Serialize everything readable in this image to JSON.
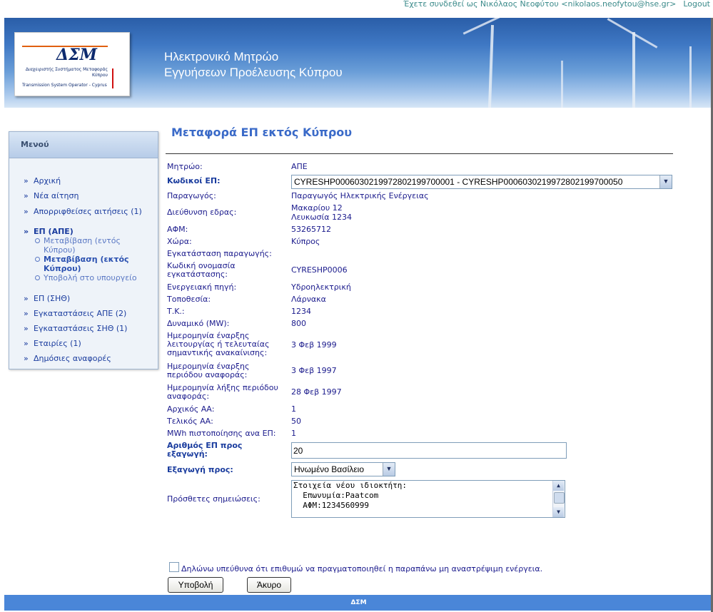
{
  "topbar": {
    "login_text": "Έχετε συνδεθεί ως Νικόλαος Νεοφύτου <nikolaos.neofytou@hse.gr>",
    "logout": "Logout"
  },
  "banner": {
    "logo_main": "ΔΣΜ",
    "logo_sub": "Διαχειριστής Συστήματος Μεταφοράς Κύπρου",
    "logo_en": "Transmission System Operator - Cyprus",
    "title_line1": "Ηλεκτρονικό Μητρώο",
    "title_line2": "Εγγυήσεων Προέλευσης Κύπρου"
  },
  "sidebar": {
    "header": "Μενού",
    "items": [
      "Αρχική",
      "Νέα αίτηση",
      "Απορριφθείσες αιτήσεις (1)",
      "ΕΠ (ΑΠΕ)",
      "ΕΠ (ΣΗΘ)",
      "Εγκαταστάσεις ΑΠΕ (2)",
      "Εγκαταστάσεις ΣΗΘ (1)",
      "Εταιρίες (1)",
      "Δημόσιες αναφορές"
    ],
    "subitems": [
      "Μεταβίβαση (εντός Κύπρου)",
      "Μεταβίβαση (εκτός Κύπρου)",
      "Υποβολή στο υπουργείο"
    ]
  },
  "page": {
    "title": "Μεταφορά ΕΠ εκτός Κύπρου"
  },
  "form": {
    "fields": [
      {
        "label": "Μητρώο:",
        "value": "ΑΠΕ"
      },
      {
        "label": "Κωδικοί ΕΠ:",
        "value": "CYRESHP0006030219972802199700001 - CYRESHP0006030219972802199700050"
      },
      {
        "label": "Παραγωγός:",
        "value": "Παραγωγός Ηλεκτρικής Ενέργειας"
      },
      {
        "label": "Διεύθυνση εδρας:",
        "value": "Μακαρίου 12",
        "value2": "Λευκωσία 1234"
      },
      {
        "label": "ΑΦΜ:",
        "value": "53265712"
      },
      {
        "label": "Χώρα:",
        "value": "Κύπρος"
      },
      {
        "label": "Εγκατάσταση παραγωγής:",
        "value": ""
      },
      {
        "label": "Κωδική ονομασία εγκατάστασης:",
        "value": "CYRESHP0006"
      },
      {
        "label": "Ενεργειακή πηγή:",
        "value": "Υδροηλεκτρική"
      },
      {
        "label": "Τοποθεσία:",
        "value": "Λάρνακα"
      },
      {
        "label": "Τ.Κ.:",
        "value": "1234"
      },
      {
        "label": "Δυναμικό (MW):",
        "value": "800"
      },
      {
        "label": "Ημερομηνία έναρξης λειτουργίας ή τελευταίας σημαντικής ανακαίνισης:",
        "value": "3 Φεβ 1999"
      },
      {
        "label": "Ημερομηνία έναρξης περιόδου αναφοράς:",
        "value": "3 Φεβ 1997"
      },
      {
        "label": "Ημερομηνία λήξης περιόδου αναφοράς:",
        "value": "28 Φεβ 1997"
      },
      {
        "label": "Αρχικός ΑΑ:",
        "value": "1"
      },
      {
        "label": "Τελικός ΑΑ:",
        "value": "50"
      },
      {
        "label": "MWh πιστοποίησης ανα ΕΠ:",
        "value": "1"
      },
      {
        "label": "Αριθμός ΕΠ προς εξαγωγή:",
        "value": "20"
      },
      {
        "label": "Εξαγωγή προς:",
        "value": "Ηνωμένο Βασίλειο"
      },
      {
        "label": "Πρόσθετες σημειώσεις:",
        "value": ""
      }
    ],
    "notes_lines": [
      "Στοιχεία νέου ιδιοκτήτη:",
      "  Επωνυμία:Paatcom",
      "  ΑΦΜ:1234560999"
    ],
    "declaration": "Δηλώνω υπεύθυνα ότι επιθυμώ να πραγματοποιηθεί η παραπάνω μη αναστρέψιμη ενέργεια.",
    "submit": "Υποβολή",
    "cancel": "Άκυρο"
  },
  "footer": {
    "text": "ΔΣΜ"
  }
}
